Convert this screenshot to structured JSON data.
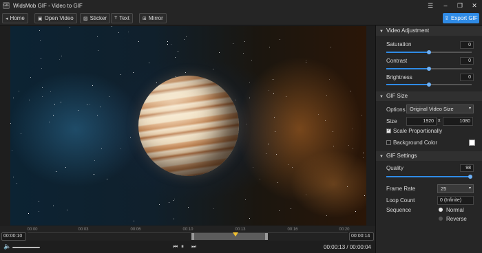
{
  "window": {
    "logo_text": "GIF",
    "title": "WidsMob GIF - Video to GIF",
    "controls": {
      "menu": "☰",
      "minimize": "–",
      "restore": "❐",
      "close": "✕"
    }
  },
  "toolbar": {
    "home_label": "Home",
    "open_video_label": "Open Video",
    "sticker_label": "Sticker",
    "text_label": "Text",
    "mirror_label": "Mirror",
    "export_label": "Export GIF",
    "accent_color": "#2f8be6"
  },
  "timeline": {
    "start_time": "00:00:10",
    "end_time": "00:00:14",
    "ticks": [
      "00:00",
      "00:03",
      "00:06",
      "00:10",
      "00:13",
      "00:16",
      "00:20"
    ]
  },
  "playback": {
    "current_time": "00:00:13",
    "separator": "/",
    "duration": "00:00:04"
  },
  "panel": {
    "video_adjustment": {
      "title": "Video Adjustment",
      "saturation_label": "Saturation",
      "saturation_value": "0",
      "saturation_level": 0.5,
      "contrast_label": "Contrast",
      "contrast_value": "0",
      "contrast_level": 0.5,
      "brightness_label": "Brightness",
      "brightness_value": "0",
      "brightness_level": 0.5
    },
    "gif_size": {
      "title": "GIF Size",
      "options_label": "Options",
      "options_value": "Original Video Size",
      "size_label": "Size",
      "width": "1920",
      "times": "x",
      "height": "1080",
      "scale_label": "Scale Proportionally",
      "scale_checked": true,
      "bg_label": "Background Color",
      "bg_checked": false,
      "bg_color": "#ffffff"
    },
    "gif_settings": {
      "title": "GIF Settings",
      "quality_label": "Quality",
      "quality_value": "98",
      "quality_level": 0.98,
      "frame_rate_label": "Frame Rate",
      "frame_rate_value": "25",
      "loop_label": "Loop Count",
      "loop_value": "0 (Infinite)",
      "sequence_label": "Sequence",
      "normal_label": "Normal",
      "reverse_label": "Reverse",
      "sequence_selected": "Normal"
    }
  }
}
